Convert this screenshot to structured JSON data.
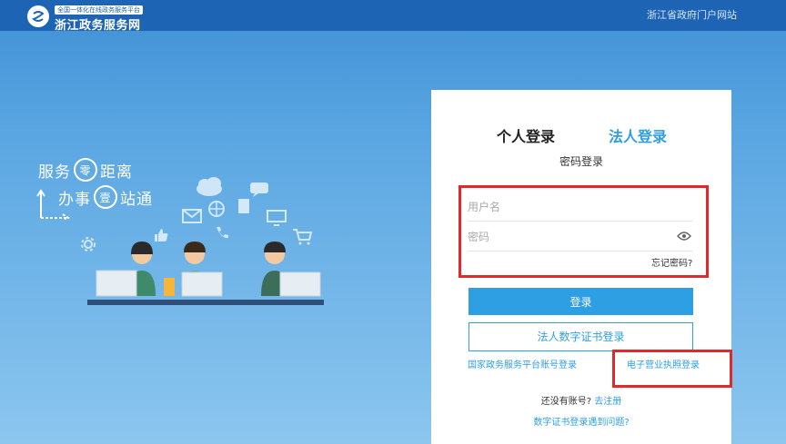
{
  "header": {
    "logo_sub": "全国一体化在线政务服务平台",
    "logo_main": "浙江政务服务网",
    "portal_link": "浙江省政府门户网站"
  },
  "illustration": {
    "slogan1_a": "服务",
    "slogan1_ring": "零",
    "slogan1_b": "距离",
    "slogan2_a": "办事",
    "slogan2_ring": "壹",
    "slogan2_b": "站通"
  },
  "login": {
    "tab_personal": "个人登录",
    "tab_legal": "法人登录",
    "subtitle": "密码登录",
    "username_placeholder": "用户名",
    "password_placeholder": "密码",
    "forgot": "忘记密码?",
    "login_button": "登录",
    "cert_button": "法人数字证书登录",
    "national_link": "国家政务服务平台账号登录",
    "license_link": "电子营业执照登录",
    "no_account": "还没有账号?",
    "register": "去注册",
    "cert_problem": "数字证书登录遇到问题?"
  },
  "colors": {
    "accent": "#2f9fe3",
    "header_bg": "#1d64b4",
    "highlight_red": "#e0292a"
  }
}
